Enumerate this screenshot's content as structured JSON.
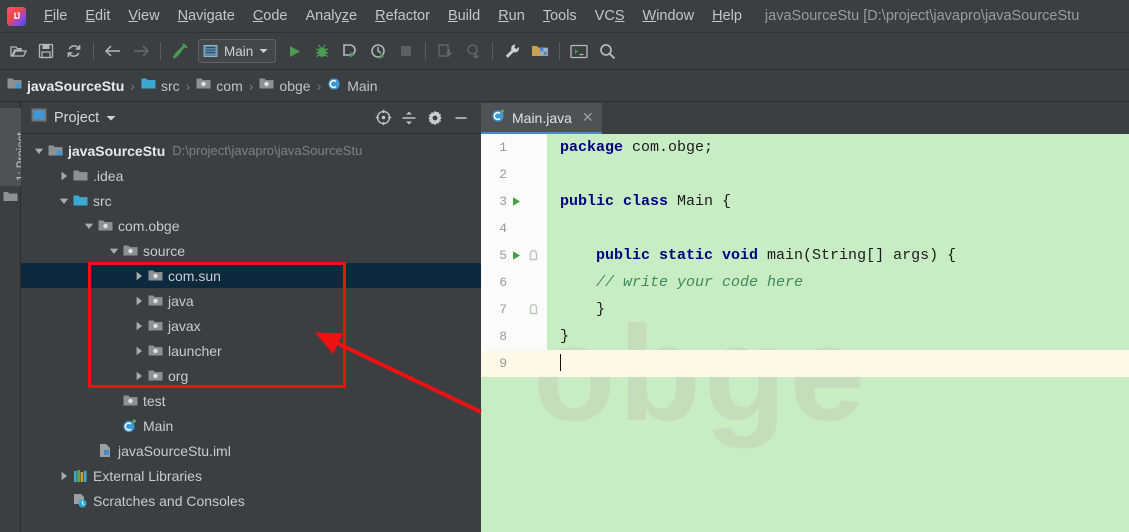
{
  "window": {
    "title": "javaSourceStu [D:\\project\\javapro\\javaSourceStu",
    "app_logo": "intellij-idea-logo"
  },
  "menubar": {
    "items": [
      {
        "label": "File",
        "mnemonic": "F"
      },
      {
        "label": "Edit",
        "mnemonic": "E"
      },
      {
        "label": "View",
        "mnemonic": "V"
      },
      {
        "label": "Navigate",
        "mnemonic": "N"
      },
      {
        "label": "Code",
        "mnemonic": "C"
      },
      {
        "label": "Analyze",
        "mnemonic": "z"
      },
      {
        "label": "Refactor",
        "mnemonic": "R"
      },
      {
        "label": "Build",
        "mnemonic": "B"
      },
      {
        "label": "Run",
        "mnemonic": "R"
      },
      {
        "label": "Tools",
        "mnemonic": "T"
      },
      {
        "label": "VCS",
        "mnemonic": "S"
      },
      {
        "label": "Window",
        "mnemonic": "W"
      },
      {
        "label": "Help",
        "mnemonic": "H"
      }
    ]
  },
  "toolbar": {
    "open_icon": "open-folder-icon",
    "save_icon": "save-icon",
    "sync_icon": "sync-refresh-icon",
    "back_icon": "back-arrow-icon",
    "forward_icon": "forward-arrow-icon",
    "build_icon": "build-hammer-icon",
    "run_config": {
      "label": "Main",
      "icon": "run-configuration-icon",
      "chevron": "chevron-down-icon"
    },
    "run_icon": "run-play-icon",
    "debug_icon": "debug-bug-icon",
    "run_coverage_icon": "run-with-coverage-icon",
    "profiler_icon": "profiler-icon",
    "stop_icon": "stop-square-icon",
    "update_project_icon": "update-project-icon",
    "commit_icon": "commit-icon",
    "settings_icon": "settings-wrench-icon",
    "project_structure_icon": "project-structure-icon",
    "terminal_icon": "terminal-icon",
    "search_icon": "search-magnifier-icon"
  },
  "breadcrumb": {
    "items": [
      {
        "label": "javaSourceStu",
        "icon": "project-module-icon"
      },
      {
        "label": "src",
        "icon": "source-folder-icon"
      },
      {
        "label": "com",
        "icon": "package-icon"
      },
      {
        "label": "obge",
        "icon": "package-icon"
      },
      {
        "label": "Main",
        "icon": "java-class-icon"
      }
    ],
    "separator": "›"
  },
  "left_strip": {
    "tab_label": "1: Project",
    "tab_icon": "project-tool-window-icon",
    "bottom_icon": "structure-folder-icon"
  },
  "project_panel": {
    "title": "Project",
    "title_icon": "project-view-icon",
    "chevron": "chevron-down-icon",
    "tools": [
      {
        "name": "select-opened-file-icon"
      },
      {
        "name": "collapse-all-icon"
      },
      {
        "name": "settings-gear-icon"
      },
      {
        "name": "hide-panel-icon"
      }
    ],
    "tree": [
      {
        "label": "javaSourceStu",
        "path": "D:\\project\\javapro\\javaSourceStu",
        "icon": "project-module-icon",
        "indent": 0,
        "twisty": "expanded",
        "bold": true,
        "selected": false
      },
      {
        "label": ".idea",
        "path": "",
        "icon": "folder-icon",
        "indent": 1,
        "twisty": "collapsed",
        "bold": false,
        "selected": false
      },
      {
        "label": "src",
        "path": "",
        "icon": "source-folder-icon",
        "indent": 1,
        "twisty": "expanded",
        "bold": false,
        "selected": false
      },
      {
        "label": "com.obge",
        "path": "",
        "icon": "package-icon",
        "indent": 2,
        "twisty": "expanded",
        "bold": false,
        "selected": false
      },
      {
        "label": "source",
        "path": "",
        "icon": "package-icon",
        "indent": 3,
        "twisty": "expanded",
        "bold": false,
        "selected": false
      },
      {
        "label": "com.sun",
        "path": "",
        "icon": "package-icon",
        "indent": 4,
        "twisty": "collapsed",
        "bold": false,
        "selected": true
      },
      {
        "label": "java",
        "path": "",
        "icon": "package-icon",
        "indent": 4,
        "twisty": "collapsed",
        "bold": false,
        "selected": false
      },
      {
        "label": "javax",
        "path": "",
        "icon": "package-icon",
        "indent": 4,
        "twisty": "collapsed",
        "bold": false,
        "selected": false
      },
      {
        "label": "launcher",
        "path": "",
        "icon": "package-icon",
        "indent": 4,
        "twisty": "collapsed",
        "bold": false,
        "selected": false
      },
      {
        "label": "org",
        "path": "",
        "icon": "package-icon",
        "indent": 4,
        "twisty": "collapsed",
        "bold": false,
        "selected": false
      },
      {
        "label": "test",
        "path": "",
        "icon": "package-icon",
        "indent": 3,
        "twisty": "none",
        "bold": false,
        "selected": false
      },
      {
        "label": "Main",
        "path": "",
        "icon": "java-class-run-icon",
        "indent": 3,
        "twisty": "none",
        "bold": false,
        "selected": false
      },
      {
        "label": "javaSourceStu.iml",
        "path": "",
        "icon": "iml-file-icon",
        "indent": 2,
        "twisty": "none",
        "bold": false,
        "selected": false
      },
      {
        "label": "External Libraries",
        "path": "",
        "icon": "external-libraries-icon",
        "indent": 1,
        "twisty": "collapsed",
        "bold": false,
        "selected": false
      },
      {
        "label": "Scratches and Consoles",
        "path": "",
        "icon": "scratches-consoles-icon",
        "indent": 1,
        "twisty": "none",
        "bold": false,
        "selected": false
      }
    ]
  },
  "editor": {
    "tab": {
      "label": "Main.java",
      "icon": "java-class-icon",
      "close_icon": "close-icon"
    },
    "watermark": "obge",
    "lines": [
      {
        "num": "1",
        "run_marker": false,
        "fold_marker": false,
        "caret": false,
        "tokens": [
          {
            "t": "package",
            "c": "kw"
          },
          {
            "t": " com.obge;",
            "c": ""
          }
        ]
      },
      {
        "num": "2",
        "run_marker": false,
        "fold_marker": false,
        "caret": false,
        "tokens": []
      },
      {
        "num": "3",
        "run_marker": true,
        "fold_marker": false,
        "caret": false,
        "tokens": [
          {
            "t": "public class",
            "c": "kw"
          },
          {
            "t": " Main {",
            "c": ""
          }
        ]
      },
      {
        "num": "4",
        "run_marker": false,
        "fold_marker": false,
        "caret": false,
        "tokens": []
      },
      {
        "num": "5",
        "run_marker": true,
        "fold_marker": true,
        "caret": false,
        "tokens": [
          {
            "t": "    ",
            "c": ""
          },
          {
            "t": "public static void",
            "c": "kw"
          },
          {
            "t": " main(String[] args) {",
            "c": ""
          }
        ]
      },
      {
        "num": "6",
        "run_marker": false,
        "fold_marker": false,
        "caret": false,
        "tokens": [
          {
            "t": "    ",
            "c": ""
          },
          {
            "t": "// write your code here",
            "c": "cm"
          }
        ]
      },
      {
        "num": "7",
        "run_marker": false,
        "fold_marker": true,
        "caret": false,
        "tokens": [
          {
            "t": "    }",
            "c": ""
          }
        ]
      },
      {
        "num": "8",
        "run_marker": false,
        "fold_marker": false,
        "caret": false,
        "tokens": [
          {
            "t": "}",
            "c": ""
          }
        ]
      },
      {
        "num": "9",
        "run_marker": false,
        "fold_marker": false,
        "caret": true,
        "tokens": []
      }
    ]
  },
  "annotations": {
    "highlight_box": {
      "label": "red-highlight-rectangle",
      "color": "#ee1111"
    },
    "arrow": {
      "label": "red-pointer-arrow",
      "color": "#ee1111"
    }
  },
  "colors": {
    "chrome_bg": "#3c3f41",
    "editor_bg": "#c8ecc4",
    "caret_line_bg": "#fdf8e7",
    "gutter_bg": "#fbfbfb",
    "selection_bg": "#0d293e",
    "keyword": "#000080",
    "comment": "#3f8a5c",
    "accent": "#4a88c7",
    "annotation_red": "#ee1111"
  }
}
